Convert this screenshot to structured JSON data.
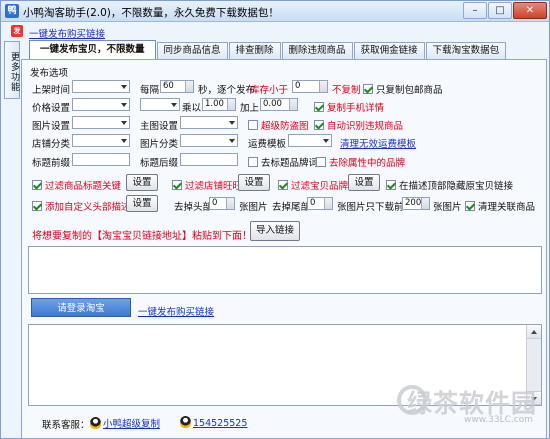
{
  "window": {
    "title": "小鸭淘客助手(2.0)，不限数量，永久免费下载数据包！"
  },
  "top_link": "一键发布购买链接",
  "sidebar_label": "更多功能",
  "tabs": [
    "一键发布宝贝，不限数量",
    "同步商品信息",
    "排查删除",
    "删除违规商品",
    "获取佣金链接",
    "下载淘宝数据包"
  ],
  "form": {
    "section_title": "发布选项",
    "listing_time_label": "上架时间",
    "interval_label": "每隔",
    "interval_value": "60",
    "interval_suffix": "秒，逐个发布",
    "stock_less_label": "库存小于",
    "stock_value": "0",
    "no_copy_label": "不复制",
    "only_copy_free_shipping": "只复制包邮商品",
    "price_label": "价格设置",
    "multiply_label": "乘以",
    "multiply_value": "1.00",
    "add_label": "加上",
    "add_value": "0.00",
    "copy_mobile_detail": "复制手机详情",
    "image_label": "图片设置",
    "main_image_label": "主图设置",
    "anti_theft_image": "超级防盗图",
    "auto_detect_violation": "自动识别违规商品",
    "shop_category_label": "店铺分类",
    "image_category_label": "图片分类",
    "shipping_template_label": "运费模板",
    "clear_shipping_template": "清理无效运费模板",
    "title_prefix_label": "标题前缀",
    "title_suffix_label": "标题后缀",
    "remove_title_brand": "去标题品牌词",
    "remove_attr_brand": "去除属性中的品牌",
    "filter_keywords": "过滤商品标题关键",
    "settings": "设置",
    "filter_shops": "过滤店铺旺旺",
    "filter_brands": "过滤宝贝品牌",
    "hide_desc_top_link": "在描述顶部隐藏原宝贝链接",
    "add_custom_header": "添加自定义头部描述",
    "remove_head_label": "去掉头部",
    "head_value": "0",
    "pic_unit": "张图片",
    "remove_tail_label": "去掉尾部",
    "tail_value": "0",
    "only_download_label": "张图片只下载前",
    "download_value": "200",
    "clear_related": "清理关联商品"
  },
  "paste_prompt": "将想要复制的【淘宝宝贝链接地址】粘贴到下面！",
  "import_button": "导入链接",
  "login_button": "请登录淘宝",
  "bottom_link": "一键发布购买链接",
  "footer": {
    "contact_label": "联系客服：",
    "support_name": "小鸭超级复制",
    "qq_number": "154525525"
  },
  "watermark": {
    "text": "绿茶软件园",
    "url": "www.33LC.com"
  },
  "colors": {
    "accent": "#e0001a",
    "link": "#1a2fd0"
  }
}
